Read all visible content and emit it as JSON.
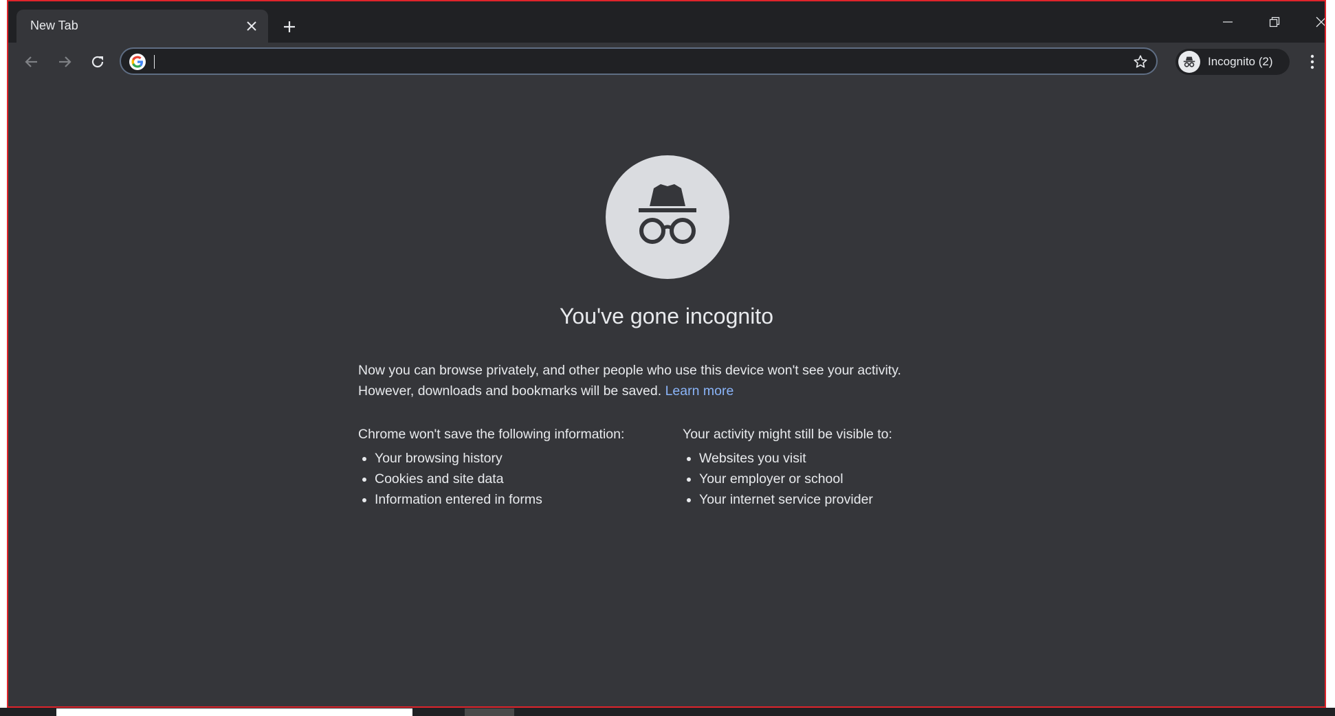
{
  "tab": {
    "title": "New Tab",
    "close_icon": "close-icon"
  },
  "window_controls": {
    "minimize_icon": "minimize-icon",
    "maximize_icon": "restore-icon",
    "close_icon": "close-icon"
  },
  "toolbar": {
    "back_icon": "arrow-left-icon",
    "forward_icon": "arrow-right-icon",
    "reload_icon": "reload-icon",
    "omnibox": {
      "value": "",
      "placeholder": "",
      "site_icon": "google-icon",
      "bookmark_icon": "star-icon"
    },
    "profile": {
      "label": "Incognito (2)",
      "avatar_icon": "incognito-icon"
    },
    "menu_icon": "more-vertical-icon"
  },
  "content": {
    "heading": "You've gone incognito",
    "intro_line1": "Now you can browse privately, and other people who use this device won't see your activity.",
    "intro_line2": "However, downloads and bookmarks will be saved.",
    "learn_more": "Learn more",
    "left_column": {
      "title": "Chrome won't save the following information:",
      "items": [
        "Your browsing history",
        "Cookies and site data",
        "Information entered in forms"
      ]
    },
    "right_column": {
      "title": "Your activity might still be visible to:",
      "items": [
        "Websites you visit",
        "Your employer or school",
        "Your internet service provider"
      ]
    }
  },
  "colors": {
    "frame": "#202124",
    "toolbar": "#35363a",
    "text": "#e8eaed",
    "link": "#8ab4f8",
    "window_border": "#e0242b"
  }
}
